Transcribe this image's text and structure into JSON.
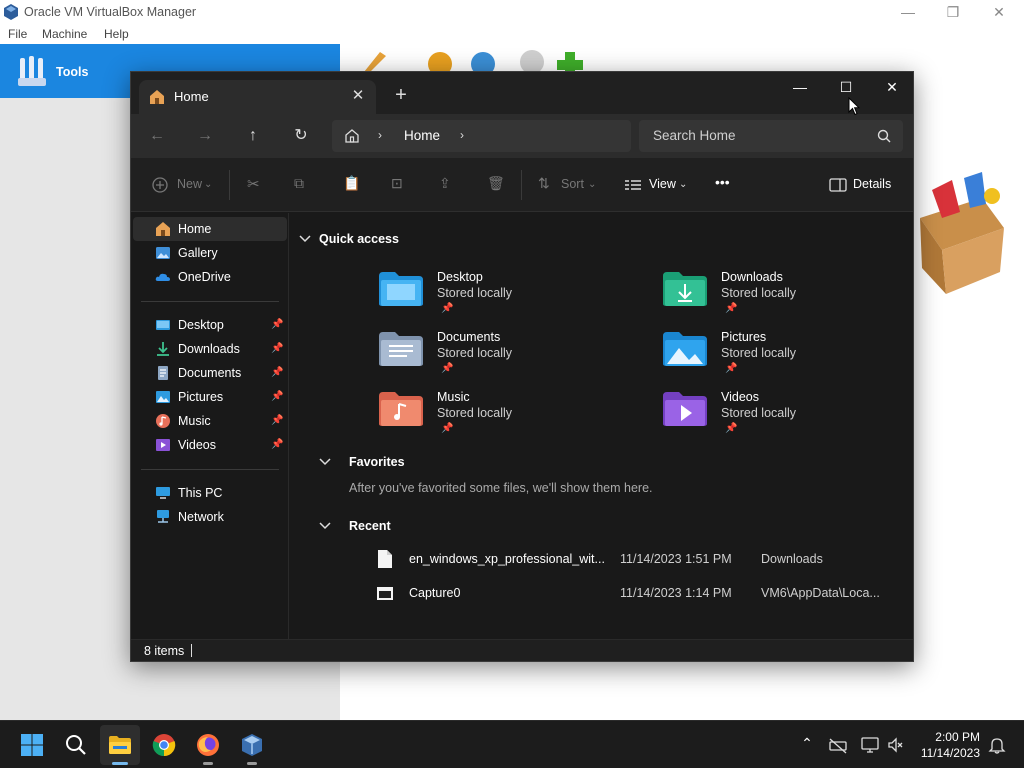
{
  "vbox": {
    "title": "Oracle VM VirtualBox Manager",
    "menu": [
      "File",
      "Machine",
      "Help"
    ],
    "tools_label": "Tools",
    "accent": "#1b86e0"
  },
  "explorer": {
    "tab_label": "Home",
    "address": "Home",
    "search_placeholder": "Search Home",
    "commands": {
      "new": "New",
      "sort": "Sort",
      "view": "View",
      "more": "•••",
      "details": "Details"
    },
    "nav": {
      "top": [
        {
          "label": "Home",
          "icon": "home-icon",
          "selected": true
        },
        {
          "label": "Gallery",
          "icon": "gallery-icon"
        },
        {
          "label": "OneDrive",
          "icon": "onedrive-icon"
        }
      ],
      "pinned": [
        {
          "label": "Desktop",
          "icon": "desktop-folder-icon"
        },
        {
          "label": "Downloads",
          "icon": "downloads-folder-icon"
        },
        {
          "label": "Documents",
          "icon": "documents-folder-icon"
        },
        {
          "label": "Pictures",
          "icon": "pictures-folder-icon"
        },
        {
          "label": "Music",
          "icon": "music-folder-icon"
        },
        {
          "label": "Videos",
          "icon": "videos-folder-icon"
        }
      ],
      "bottom": [
        {
          "label": "This PC",
          "icon": "this-pc-icon"
        },
        {
          "label": "Network",
          "icon": "network-icon"
        }
      ]
    },
    "quick_access": {
      "heading": "Quick access",
      "items": [
        {
          "name": "Desktop",
          "sub": "Stored locally",
          "icon": "desktop-folder-icon"
        },
        {
          "name": "Downloads",
          "sub": "Stored locally",
          "icon": "downloads-folder-icon"
        },
        {
          "name": "Documents",
          "sub": "Stored locally",
          "icon": "documents-folder-icon"
        },
        {
          "name": "Pictures",
          "sub": "Stored locally",
          "icon": "pictures-folder-icon"
        },
        {
          "name": "Music",
          "sub": "Stored locally",
          "icon": "music-folder-icon"
        },
        {
          "name": "Videos",
          "sub": "Stored locally",
          "icon": "videos-folder-icon"
        }
      ]
    },
    "favorites": {
      "heading": "Favorites",
      "empty_text": "After you've favorited some files, we'll show them here."
    },
    "recent": {
      "heading": "Recent",
      "rows": [
        {
          "name": "en_windows_xp_professional_wit...",
          "date": "11/14/2023 1:51 PM",
          "location": "Downloads",
          "icon": "file-icon"
        },
        {
          "name": "Capture0",
          "date": "11/14/2023 1:14 PM",
          "location": "VM6\\AppData\\Loca...",
          "icon": "image-file-icon"
        }
      ]
    },
    "status": "8 items"
  },
  "taskbar": {
    "apps": [
      "start-icon",
      "search-icon",
      "file-explorer-icon",
      "chrome-icon",
      "firefox-icon",
      "virtualbox-icon"
    ],
    "time": "2:00 PM",
    "date": "11/14/2023"
  }
}
